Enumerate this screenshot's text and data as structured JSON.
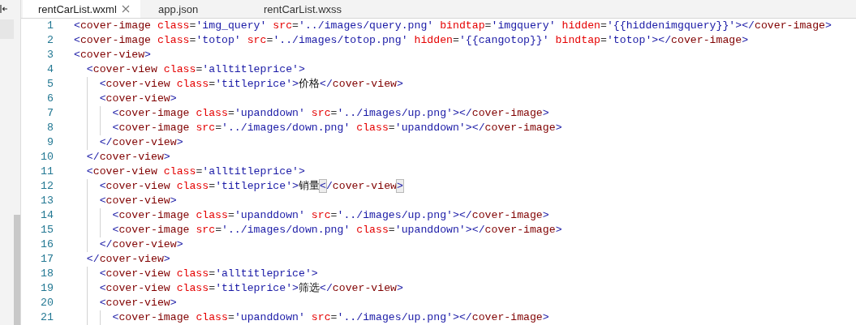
{
  "tabs": [
    {
      "label": "rentCarList.wxml",
      "selected": true
    },
    {
      "label": "app.json",
      "selected": false
    },
    {
      "label": "rentCarList.wxss",
      "selected": false
    }
  ],
  "lines": [
    {
      "number": "1",
      "code": "<cover-image class='img_query' src='../images/query.png' bindtap='imgquery' hidden='{{hiddenimgquery}}'></cover-image>",
      "bracket_match": false
    },
    {
      "number": "2",
      "code": "<cover-image class='totop' src='../images/totop.png' hidden='{{cangotop}}' bindtap='totop'></cover-image>",
      "bracket_match": false
    },
    {
      "number": "3",
      "code": "<cover-view>",
      "bracket_match": false
    },
    {
      "number": "4",
      "code": "  <cover-view class='alltitleprice'>",
      "bracket_match": false
    },
    {
      "number": "5",
      "code": "    <cover-view class='titleprice'>价格</cover-view>",
      "bracket_match": false
    },
    {
      "number": "6",
      "code": "    <cover-view>",
      "bracket_match": false
    },
    {
      "number": "7",
      "code": "      <cover-image class='upanddown' src='../images/up.png'></cover-image>",
      "bracket_match": false
    },
    {
      "number": "8",
      "code": "      <cover-image src='../images/down.png' class='upanddown'></cover-image>",
      "bracket_match": false
    },
    {
      "number": "9",
      "code": "    </cover-view>",
      "bracket_match": false
    },
    {
      "number": "10",
      "code": "  </cover-view>",
      "bracket_match": false
    },
    {
      "number": "11",
      "code": "  <cover-view class='alltitleprice'>",
      "bracket_match": false
    },
    {
      "number": "12",
      "code": "    <cover-view class='titleprice'>销量</cover-view>",
      "bracket_match": true
    },
    {
      "number": "13",
      "code": "    <cover-view>",
      "bracket_match": false
    },
    {
      "number": "14",
      "code": "      <cover-image class='upanddown' src='../images/up.png'></cover-image>",
      "bracket_match": false
    },
    {
      "number": "15",
      "code": "      <cover-image src='../images/down.png' class='upanddown'></cover-image>",
      "bracket_match": false
    },
    {
      "number": "16",
      "code": "    </cover-view>",
      "bracket_match": false
    },
    {
      "number": "17",
      "code": "  </cover-view>",
      "bracket_match": false
    },
    {
      "number": "18",
      "code": "    <cover-view class='alltitleprice'>",
      "bracket_match": false
    },
    {
      "number": "19",
      "code": "    <cover-view class='titleprice'>筛选</cover-view>",
      "bracket_match": false
    },
    {
      "number": "20",
      "code": "    <cover-view>",
      "bracket_match": false
    },
    {
      "number": "21",
      "code": "      <cover-image class='upanddown' src='../images/up.png'></cover-image>",
      "bracket_match": false
    }
  ]
}
